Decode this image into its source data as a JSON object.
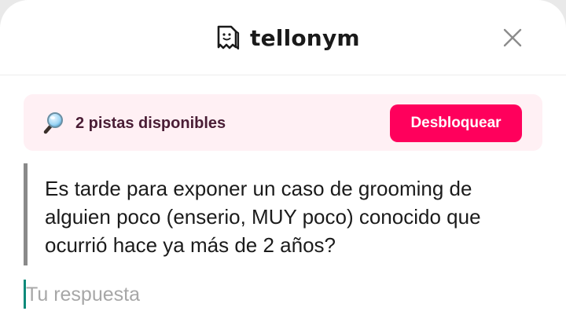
{
  "header": {
    "brand_name": "tellonym",
    "logo_icon": "tellonym-logo-icon",
    "close_icon": "close-icon"
  },
  "hints": {
    "icon": "magnifier-icon",
    "label": "2 pistas disponibles",
    "unlock_label": "Desbloquear"
  },
  "question": {
    "text": "Es tarde para exponer un caso de grooming de alguien poco (enserio, MUY poco) conocido que ocurrió hace ya más de 2 años?"
  },
  "answer": {
    "placeholder": "Tu respuesta",
    "value": ""
  },
  "colors": {
    "accent": "#ff005c",
    "hints_background": "#fff0f4",
    "caret": "#0b8a7a",
    "question_border": "#8a8a8a"
  }
}
